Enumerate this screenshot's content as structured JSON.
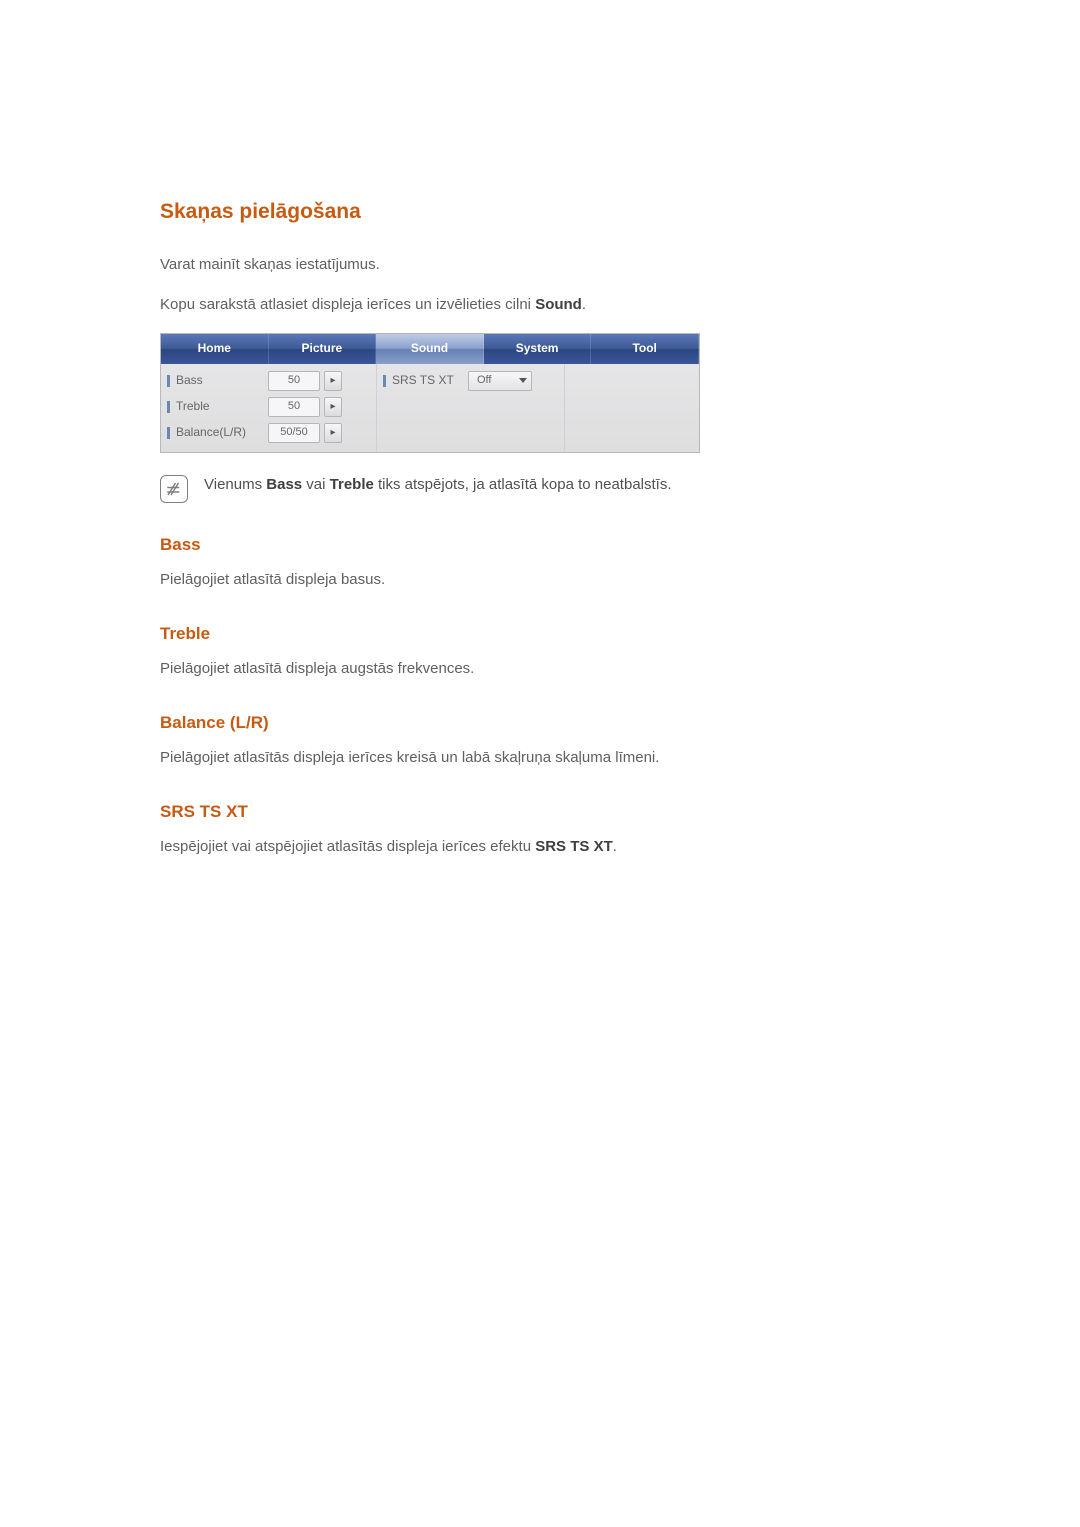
{
  "heading_main": "Skaņas pielāgošana",
  "intro_1": "Varat mainīt skaņas iestatījumus.",
  "intro_2_pre": "Kopu sarakstā atlasiet displeja ierīces un izvēlieties cilni ",
  "intro_2_bold": "Sound",
  "intro_2_post": ".",
  "tabs": [
    "Home",
    "Picture",
    "Sound",
    "System",
    "Tool"
  ],
  "active_tab_index": 2,
  "panel": {
    "col1": [
      {
        "label": "Bass",
        "value": "50"
      },
      {
        "label": "Treble",
        "value": "50"
      },
      {
        "label": "Balance(L/R)",
        "value": "50/50"
      }
    ],
    "col2": {
      "label": "SRS TS XT",
      "value": "Off"
    }
  },
  "note_pre": "Vienums ",
  "note_b1": "Bass",
  "note_mid": " vai ",
  "note_b2": "Treble",
  "note_post": " tiks atspējots, ja atlasītā kopa to neatbalstīs.",
  "sections": {
    "bass": {
      "title": "Bass",
      "text": "Pielāgojiet atlasītā displeja basus."
    },
    "treble": {
      "title": "Treble",
      "text": "Pielāgojiet atlasītā displeja augstās frekvences."
    },
    "balance": {
      "title": "Balance (L/R)",
      "text": "Pielāgojiet atlasītās displeja ierīces kreisā un labā skaļruņa skaļuma līmeni."
    },
    "srs": {
      "title": "SRS TS XT",
      "text_pre": "Iespējojiet vai atspējojiet atlasītās displeja ierīces efektu ",
      "text_bold": "SRS TS XT",
      "text_post": "."
    }
  }
}
